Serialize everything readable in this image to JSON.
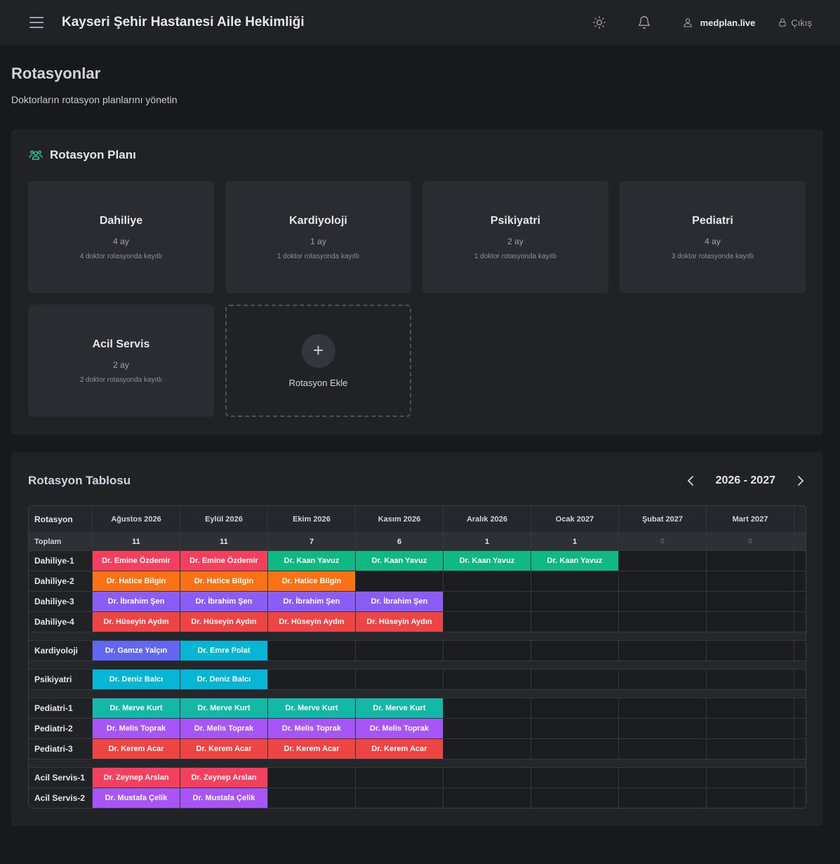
{
  "header": {
    "title": "Kayseri Şehir Hastanesi Aile Hekimliği",
    "user": "medplan.live",
    "logout": "Çıkış"
  },
  "page": {
    "title": "Rotasyonlar",
    "subtitle": "Doktorların rotasyon planlarını yönetin"
  },
  "plan": {
    "title": "Rotasyon Planı",
    "cards": [
      {
        "name": "Dahiliye",
        "duration": "4 ay",
        "count": "4 doktor rotasyonda kayıtlı"
      },
      {
        "name": "Kardiyoloji",
        "duration": "1 ay",
        "count": "1 doktor rotasyonda kayıtlı"
      },
      {
        "name": "Psikiyatri",
        "duration": "2 ay",
        "count": "1 doktor rotasyonda kayıtlı"
      },
      {
        "name": "Pediatri",
        "duration": "4 ay",
        "count": "3 doktor rotasyonda kayıtlı"
      },
      {
        "name": "Acil Servis",
        "duration": "2 ay",
        "count": "2 doktor rotasyonda kayıtlı"
      }
    ],
    "add_label": "Rotasyon Ekle"
  },
  "table": {
    "title": "Rotasyon Tablosu",
    "year": "2026 - 2027",
    "first_col": "Rotasyon",
    "total_label": "Toplam",
    "months": [
      "Ağustos 2026",
      "Eylül 2026",
      "Ekim 2026",
      "Kasım 2026",
      "Aralık 2026",
      "Ocak 2027",
      "Şubat 2027",
      "Mart 2027"
    ],
    "totals": [
      "11",
      "11",
      "7",
      "6",
      "1",
      "1",
      "0",
      "0"
    ],
    "groups": [
      [
        {
          "label": "Dahiliye-1",
          "cells": [
            [
              "Dr. Emine Özdemir",
              "#f43f5e"
            ],
            [
              "Dr. Emine Özdemir",
              "#f43f5e"
            ],
            [
              "Dr. Kaan Yavuz",
              "#10b981"
            ],
            [
              "Dr. Kaan Yavuz",
              "#10b981"
            ],
            [
              "Dr. Kaan Yavuz",
              "#10b981"
            ],
            [
              "Dr. Kaan Yavuz",
              "#10b981"
            ],
            null,
            null
          ]
        },
        {
          "label": "Dahiliye-2",
          "cells": [
            [
              "Dr. Hatice Bilgin",
              "#f97316"
            ],
            [
              "Dr. Hatice Bilgin",
              "#f97316"
            ],
            [
              "Dr. Hatice Bilgin",
              "#f97316"
            ],
            null,
            null,
            null,
            null,
            null
          ]
        },
        {
          "label": "Dahiliye-3",
          "cells": [
            [
              "Dr. İbrahim Şen",
              "#8b5cf6"
            ],
            [
              "Dr. İbrahim Şen",
              "#8b5cf6"
            ],
            [
              "Dr. İbrahim Şen",
              "#8b5cf6"
            ],
            [
              "Dr. İbrahim Şen",
              "#8b5cf6"
            ],
            null,
            null,
            null,
            null
          ]
        },
        {
          "label": "Dahiliye-4",
          "cells": [
            [
              "Dr. Hüseyin Aydın",
              "#ef4444"
            ],
            [
              "Dr. Hüseyin Aydın",
              "#ef4444"
            ],
            [
              "Dr. Hüseyin Aydın",
              "#ef4444"
            ],
            [
              "Dr. Hüseyin Aydın",
              "#ef4444"
            ],
            null,
            null,
            null,
            null
          ]
        }
      ],
      [
        {
          "label": "Kardiyoloji",
          "cells": [
            [
              "Dr. Gamze Yalçın",
              "#6366f1"
            ],
            [
              "Dr. Emre Polat",
              "#06b6d4"
            ],
            null,
            null,
            null,
            null,
            null,
            null
          ]
        }
      ],
      [
        {
          "label": "Psikiyatri",
          "cells": [
            [
              "Dr. Deniz Balcı",
              "#06b6d4"
            ],
            [
              "Dr. Deniz Balcı",
              "#06b6d4"
            ],
            null,
            null,
            null,
            null,
            null,
            null
          ]
        }
      ],
      [
        {
          "label": "Pediatri-1",
          "cells": [
            [
              "Dr. Merve Kurt",
              "#14b8a6"
            ],
            [
              "Dr. Merve Kurt",
              "#14b8a6"
            ],
            [
              "Dr. Merve Kurt",
              "#14b8a6"
            ],
            [
              "Dr. Merve Kurt",
              "#14b8a6"
            ],
            null,
            null,
            null,
            null
          ]
        },
        {
          "label": "Pediatri-2",
          "cells": [
            [
              "Dr. Melis Toprak",
              "#a855f7"
            ],
            [
              "Dr. Melis Toprak",
              "#a855f7"
            ],
            [
              "Dr. Melis Toprak",
              "#a855f7"
            ],
            [
              "Dr. Melis Toprak",
              "#a855f7"
            ],
            null,
            null,
            null,
            null
          ]
        },
        {
          "label": "Pediatri-3",
          "cells": [
            [
              "Dr. Kerem Acar",
              "#ef4444"
            ],
            [
              "Dr. Kerem Acar",
              "#ef4444"
            ],
            [
              "Dr. Kerem Acar",
              "#ef4444"
            ],
            [
              "Dr. Kerem Acar",
              "#ef4444"
            ],
            null,
            null,
            null,
            null
          ]
        }
      ],
      [
        {
          "label": "Acil Servis-1",
          "cells": [
            [
              "Dr. Zeynep Arslan",
              "#f43f5e"
            ],
            [
              "Dr. Zeynep Arslan",
              "#f43f5e"
            ],
            null,
            null,
            null,
            null,
            null,
            null
          ]
        },
        {
          "label": "Acil Servis-2",
          "cells": [
            [
              "Dr. Mustafa Çelik",
              "#a855f7"
            ],
            [
              "Dr. Mustafa Çelik",
              "#a855f7"
            ],
            null,
            null,
            null,
            null,
            null,
            null
          ]
        }
      ]
    ]
  }
}
